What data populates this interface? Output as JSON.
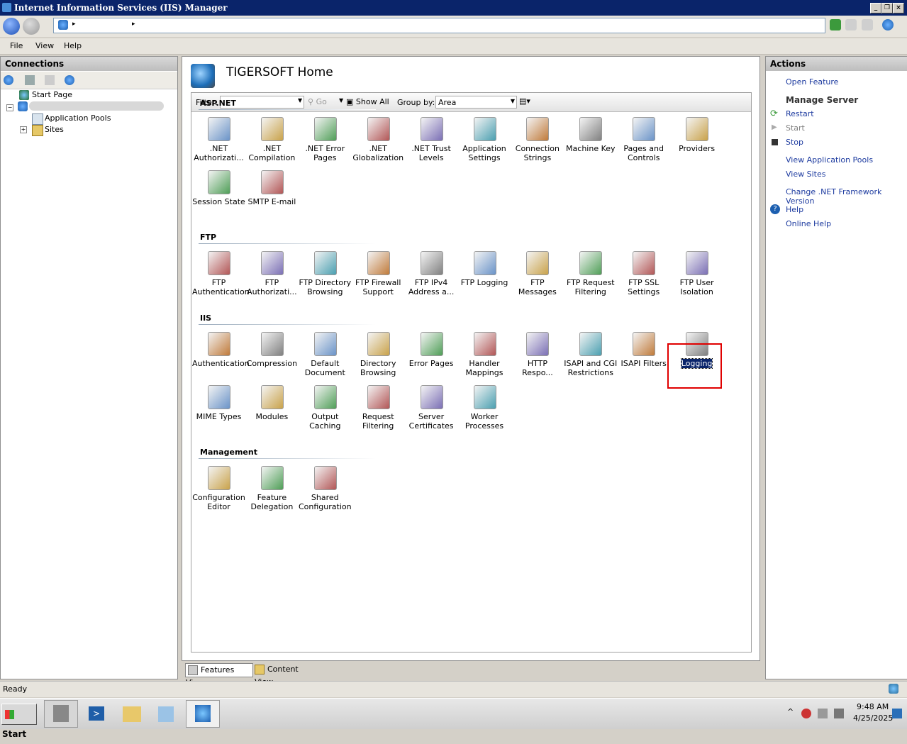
{
  "window": {
    "title": "Internet Information Services (IIS) Manager",
    "min": "_",
    "max": "❐",
    "close": "×"
  },
  "address": {
    "sep1": "▸",
    "sep2": "▸"
  },
  "menu": [
    "File",
    "View",
    "Help"
  ],
  "connections": {
    "header": "Connections",
    "tree": {
      "start_page": "Start Page",
      "app_pools": "Application Pools",
      "sites": "Sites"
    }
  },
  "center": {
    "title": "TIGERSOFT Home",
    "filter": {
      "label": "Filter:",
      "go": "Go",
      "show_all": "Show All",
      "group_by": "Group by:",
      "group_value": "Area"
    },
    "sections": [
      {
        "name": "ASP.NET",
        "items": [
          ".NET Authorizati...",
          ".NET Compilation",
          ".NET Error Pages",
          ".NET Globalization",
          ".NET Trust Levels",
          "Application Settings",
          "Connection Strings",
          "Machine Key",
          "Pages and Controls",
          "Providers",
          "Session State",
          "SMTP E-mail"
        ]
      },
      {
        "name": "FTP",
        "items": [
          "FTP Authentication",
          "FTP Authorizati...",
          "FTP Directory Browsing",
          "FTP Firewall Support",
          "FTP IPv4 Address a...",
          "FTP Logging",
          "FTP Messages",
          "FTP Request Filtering",
          "FTP SSL Settings",
          "FTP User Isolation"
        ]
      },
      {
        "name": "IIS",
        "items": [
          "Authentication",
          "Compression",
          "Default Document",
          "Directory Browsing",
          "Error Pages",
          "Handler Mappings",
          "HTTP Respo...",
          "ISAPI and CGI Restrictions",
          "ISAPI Filters",
          "Logging",
          "MIME Types",
          "Modules",
          "Output Caching",
          "Request Filtering",
          "Server Certificates",
          "Worker Processes"
        ]
      },
      {
        "name": "Management",
        "items": [
          "Configuration Editor",
          "Feature Delegation",
          "Shared Configuration"
        ]
      }
    ],
    "selected": "Logging"
  },
  "tabs": {
    "features": "Features View",
    "content": "Content View"
  },
  "actions": {
    "header": "Actions",
    "open_feature": "Open Feature",
    "manage_server": "Manage Server",
    "restart": "Restart",
    "start": "Start",
    "stop": "Stop",
    "view_app_pools": "View Application Pools",
    "view_sites": "View Sites",
    "change_net": "Change .NET Framework Version",
    "help": "Help",
    "online_help": "Online Help"
  },
  "status": {
    "text": "Ready"
  },
  "taskbar": {
    "start": "Start",
    "time": "9:48 AM",
    "date": "4/25/2025"
  },
  "colors": {
    "selection": "#0a246a",
    "link": "#1c3a9f",
    "highlight_box": "#e00000"
  }
}
